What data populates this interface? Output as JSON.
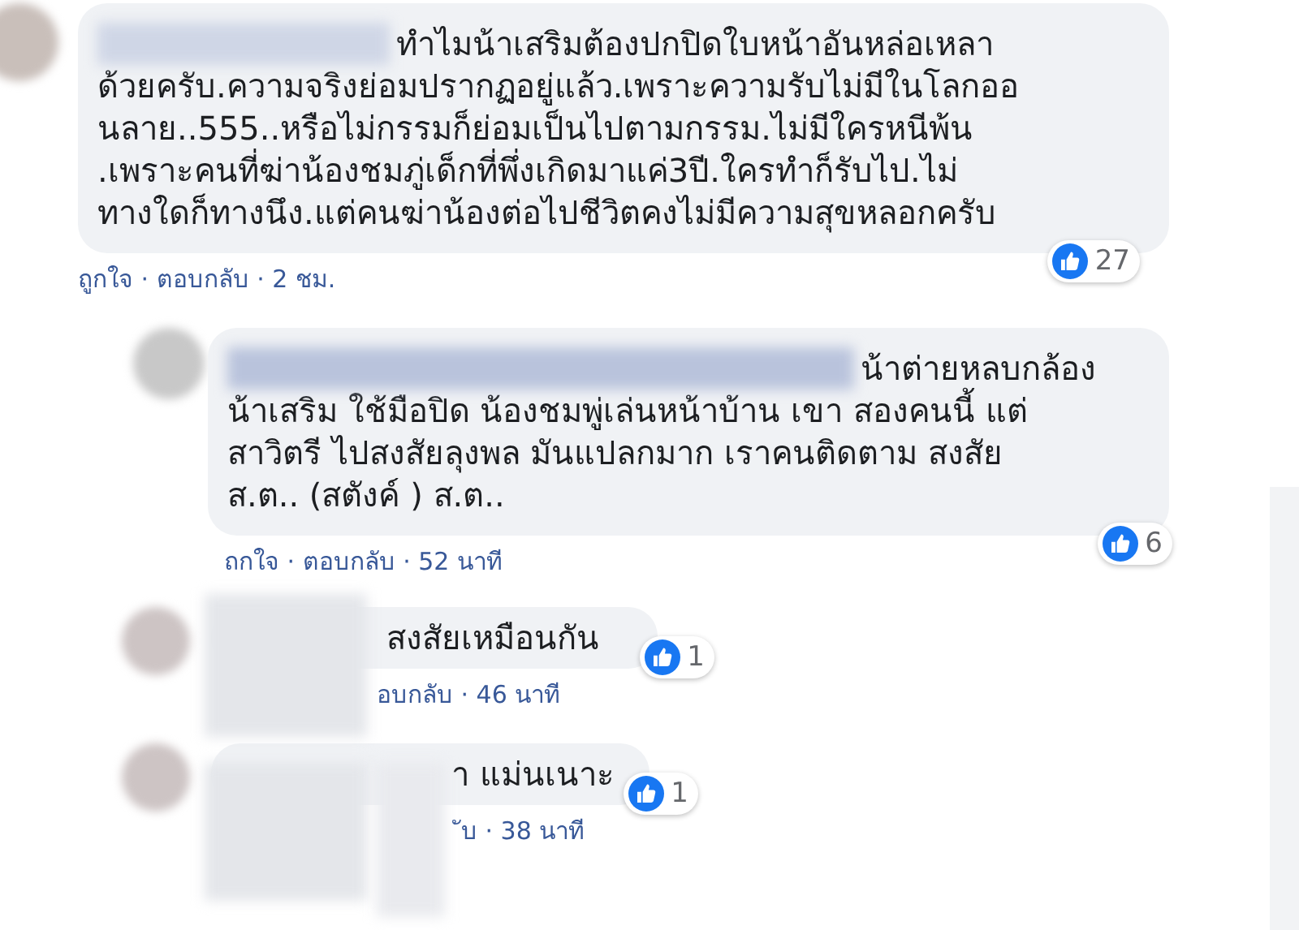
{
  "comments": [
    {
      "lines": [
        "ทำไมน้าเสริมต้องปกปิดใบหน้าอันหล่อเหลา",
        "ด้วยครับ.ความจริงย่อมปรากฏอยู่แล้ว.เพราะความรับไม่มีในโลกออ",
        "นลาย..555..หรือไม่กรรมก็ย่อมเป็นไปตามกรรม.ไม่มีใครหนีพ้น",
        ".เพราะคนที่ฆ่าน้องชมภู่เด็กที่พึ่งเกิดมาแค่3ปี.ใครทำก็รับไป.ไม่",
        "ทางใดก็ทางนึง.แต่คนฆ่าน้องต่อไปชีวิตคงไม่มีความสุขหลอกครับ"
      ],
      "likes": "27",
      "actions": "ถูกใจ · ตอบกลับ · 2 ชม."
    },
    {
      "lines": [
        "น้าต่ายหลบกล้อง",
        "น้าเสริม ใช้มือปิด น้องชมพู่เล่นหน้าบ้าน เขา สองคนนี้ แต่",
        "สาวิตรี ไปสงสัยลุงพล มันแปลกมาก เราคนติดตาม สงสัย",
        "ส.ต.. (สตังค์ ) ส.ต.."
      ],
      "likes": "6",
      "actions": "ถกใจ · ตอบกลับ · 52 นาที"
    },
    {
      "lines": [
        "สงสัยเหมือนกัน"
      ],
      "likes": "1",
      "actions": "อบกลับ · 46 นาที"
    },
    {
      "lines": [
        "า แม่นเนาะ"
      ],
      "likes": "1",
      "actions": "ับ · 38 นาที"
    }
  ]
}
